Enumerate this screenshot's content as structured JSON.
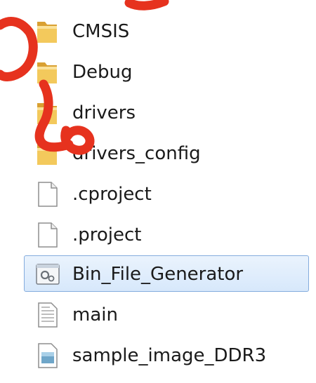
{
  "file_list": {
    "items": [
      {
        "label": "CMSIS",
        "icon": "folder-icon",
        "selected": false
      },
      {
        "label": "Debug",
        "icon": "folder-icon",
        "selected": false
      },
      {
        "label": "drivers",
        "icon": "folder-icon",
        "selected": false
      },
      {
        "label": "drivers_config",
        "icon": "folder-icon",
        "selected": false
      },
      {
        "label": ".cproject",
        "icon": "blank-file-icon",
        "selected": false
      },
      {
        "label": ".project",
        "icon": "blank-file-icon",
        "selected": false
      },
      {
        "label": "Bin_File_Generator",
        "icon": "batch-file-icon",
        "selected": true
      },
      {
        "label": "main",
        "icon": "text-file-icon",
        "selected": false
      },
      {
        "label": "sample_image_DDR3",
        "icon": "image-file-icon",
        "selected": false
      }
    ]
  },
  "colors": {
    "selection_border": "#84acdd",
    "selection_fill": "#d7e8fb",
    "folder": "#e9b84a",
    "watermark": "#e6321e"
  }
}
